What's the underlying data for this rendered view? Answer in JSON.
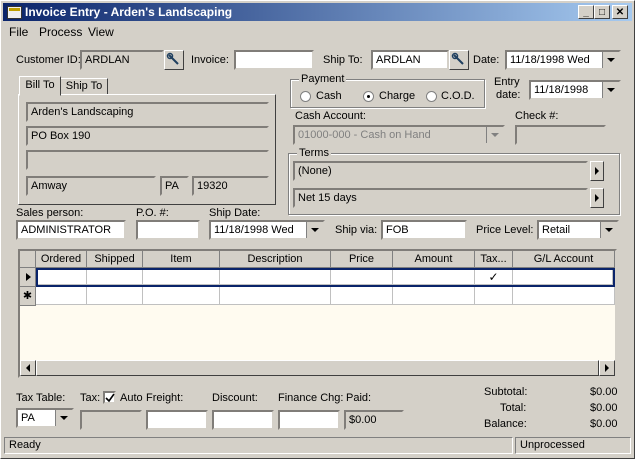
{
  "window": {
    "title": "Invoice Entry - Arden's Landscaping"
  },
  "menu": [
    "File",
    "Process",
    "View"
  ],
  "header": {
    "customer_id_label": "Customer ID:",
    "customer_id": "ARDLAN",
    "invoice_label": "Invoice:",
    "invoice": "",
    "ship_to_label": "Ship To:",
    "ship_to": "ARDLAN",
    "date_label": "Date:",
    "date": "11/18/1998 Wed"
  },
  "address_tabs": [
    "Bill To",
    "Ship To"
  ],
  "bill_to": {
    "name": "Arden's Landscaping",
    "address1": "PO Box 190",
    "address2": "",
    "city": "Amway",
    "state": "PA",
    "zip": "19320"
  },
  "payment": {
    "label": "Payment",
    "options": [
      "Cash",
      "Charge",
      "C.O.D."
    ],
    "selected": "Charge"
  },
  "entry_date": {
    "label_line1": "Entry",
    "label_line2": "date:",
    "value": "11/18/1998"
  },
  "cash_account": {
    "label": "Cash Account:",
    "value": "01000-000 - Cash on Hand"
  },
  "check": {
    "label": "Check #:",
    "value": ""
  },
  "terms": {
    "label": "Terms",
    "value1": "(None)",
    "value2": "Net  15 days"
  },
  "order": {
    "sales_person_label": "Sales person:",
    "sales_person": "ADMINISTRATOR",
    "po_label": "P.O. #:",
    "po": "",
    "ship_date_label": "Ship Date:",
    "ship_date": "11/18/1998 Wed",
    "ship_via_label": "Ship via:",
    "ship_via": "FOB",
    "price_level_label": "Price Level:",
    "price_level": "Retail"
  },
  "grid": {
    "columns": [
      "Ordered",
      "Shipped",
      "Item",
      "Description",
      "Price",
      "Amount",
      "Tax...",
      "G/L Account"
    ],
    "tax_check": "✓",
    "new_row_marker": "✱"
  },
  "footer": {
    "tax_table_label": "Tax Table:",
    "tax_table": "PA",
    "tax_label": "Tax:",
    "auto_label": "Auto",
    "freight_label": "Freight:",
    "discount_label": "Discount:",
    "finance_label": "Finance Chg:",
    "paid_label": "Paid:",
    "paid": "$0.00",
    "subtotal_label": "Subtotal:",
    "subtotal": "$0.00",
    "total_label": "Total:",
    "total": "$0.00",
    "balance_label": "Balance:",
    "balance": "$0.00"
  },
  "status": {
    "left": "Ready",
    "right": "Unprocessed"
  }
}
